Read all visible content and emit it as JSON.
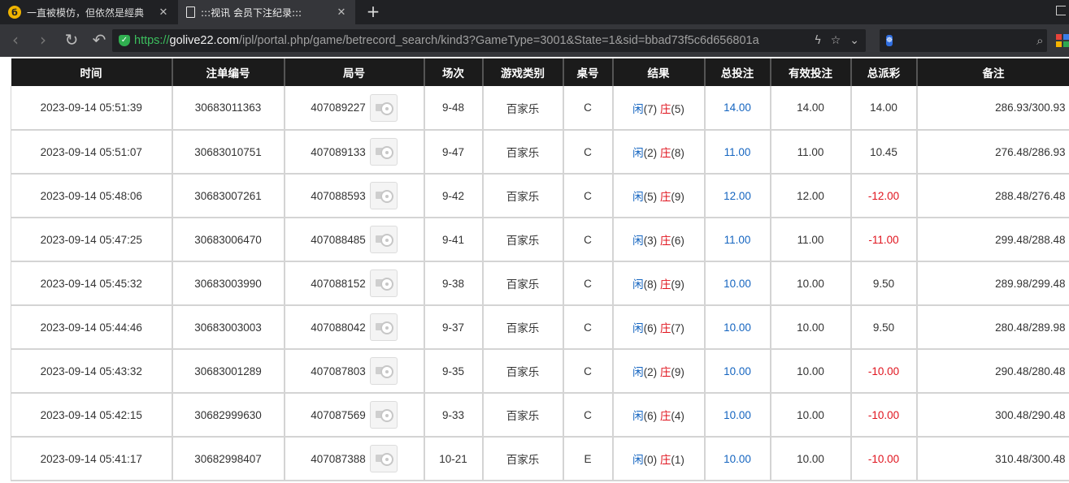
{
  "browser": {
    "tabs": [
      {
        "title": "一直被模仿，但依然是經典",
        "icon": "circle-logo-icon",
        "active": false
      },
      {
        "title": ":::视讯 会员下注纪录:::",
        "icon": "document-icon",
        "active": true
      }
    ],
    "new_tab_label": "+",
    "url": {
      "scheme": "https://",
      "host": "golive22.com",
      "rest": "/ipl/portal.php/game/betrecord_search/kind3?GameType=3001&State=1&sid=bbad73f5c6d656801a"
    },
    "search_placeholder": "",
    "colors": {
      "tab_bar": "#202124",
      "toolbar": "#35363a",
      "secure": "#3cbf5e"
    }
  },
  "table": {
    "headers": [
      "时间",
      "注单编号",
      "局号",
      "场次",
      "游戏类别",
      "桌号",
      "结果",
      "总投注",
      "有效投注",
      "总派彩",
      "备注"
    ],
    "rows": [
      {
        "time": "2023-09-14 05:51:39",
        "bet_no": "30683011363",
        "round_no": "407089227",
        "session": "9-48",
        "game": "百家乐",
        "table": "C",
        "player_label": "闲",
        "player_score": "(7)",
        "banker_label": "庄",
        "banker_score": "(5)",
        "total_bet": "14.00",
        "valid_bet": "14.00",
        "payout": "14.00",
        "payout_neg": false,
        "remark": "286.93/300.93"
      },
      {
        "time": "2023-09-14 05:51:07",
        "bet_no": "30683010751",
        "round_no": "407089133",
        "session": "9-47",
        "game": "百家乐",
        "table": "C",
        "player_label": "闲",
        "player_score": "(2)",
        "banker_label": "庄",
        "banker_score": "(8)",
        "total_bet": "11.00",
        "valid_bet": "11.00",
        "payout": "10.45",
        "payout_neg": false,
        "remark": "276.48/286.93"
      },
      {
        "time": "2023-09-14 05:48:06",
        "bet_no": "30683007261",
        "round_no": "407088593",
        "session": "9-42",
        "game": "百家乐",
        "table": "C",
        "player_label": "闲",
        "player_score": "(5)",
        "banker_label": "庄",
        "banker_score": "(9)",
        "total_bet": "12.00",
        "valid_bet": "12.00",
        "payout": "-12.00",
        "payout_neg": true,
        "remark": "288.48/276.48"
      },
      {
        "time": "2023-09-14 05:47:25",
        "bet_no": "30683006470",
        "round_no": "407088485",
        "session": "9-41",
        "game": "百家乐",
        "table": "C",
        "player_label": "闲",
        "player_score": "(3)",
        "banker_label": "庄",
        "banker_score": "(6)",
        "total_bet": "11.00",
        "valid_bet": "11.00",
        "payout": "-11.00",
        "payout_neg": true,
        "remark": "299.48/288.48"
      },
      {
        "time": "2023-09-14 05:45:32",
        "bet_no": "30683003990",
        "round_no": "407088152",
        "session": "9-38",
        "game": "百家乐",
        "table": "C",
        "player_label": "闲",
        "player_score": "(8)",
        "banker_label": "庄",
        "banker_score": "(9)",
        "total_bet": "10.00",
        "valid_bet": "10.00",
        "payout": "9.50",
        "payout_neg": false,
        "remark": "289.98/299.48"
      },
      {
        "time": "2023-09-14 05:44:46",
        "bet_no": "30683003003",
        "round_no": "407088042",
        "session": "9-37",
        "game": "百家乐",
        "table": "C",
        "player_label": "闲",
        "player_score": "(6)",
        "banker_label": "庄",
        "banker_score": "(7)",
        "total_bet": "10.00",
        "valid_bet": "10.00",
        "payout": "9.50",
        "payout_neg": false,
        "remark": "280.48/289.98"
      },
      {
        "time": "2023-09-14 05:43:32",
        "bet_no": "30683001289",
        "round_no": "407087803",
        "session": "9-35",
        "game": "百家乐",
        "table": "C",
        "player_label": "闲",
        "player_score": "(2)",
        "banker_label": "庄",
        "banker_score": "(9)",
        "total_bet": "10.00",
        "valid_bet": "10.00",
        "payout": "-10.00",
        "payout_neg": true,
        "remark": "290.48/280.48"
      },
      {
        "time": "2023-09-14 05:42:15",
        "bet_no": "30682999630",
        "round_no": "407087569",
        "session": "9-33",
        "game": "百家乐",
        "table": "C",
        "player_label": "闲",
        "player_score": "(6)",
        "banker_label": "庄",
        "banker_score": "(4)",
        "total_bet": "10.00",
        "valid_bet": "10.00",
        "payout": "-10.00",
        "payout_neg": true,
        "remark": "300.48/290.48"
      },
      {
        "time": "2023-09-14 05:41:17",
        "bet_no": "30682998407",
        "round_no": "407087388",
        "session": "10-21",
        "game": "百家乐",
        "table": "E",
        "player_label": "闲",
        "player_score": "(0)",
        "banker_label": "庄",
        "banker_score": "(1)",
        "total_bet": "10.00",
        "valid_bet": "10.00",
        "payout": "-10.00",
        "payout_neg": true,
        "remark": "310.48/300.48"
      }
    ],
    "colors": {
      "header_bg": "#1b1b1b",
      "blue": "#1565c0",
      "red": "#e0141e"
    }
  }
}
